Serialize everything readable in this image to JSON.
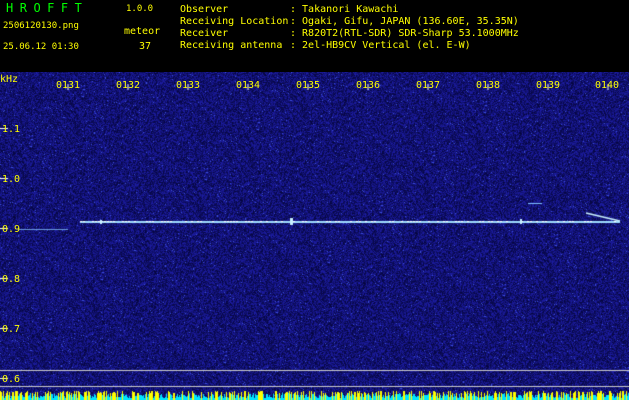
{
  "header": {
    "app_title": "HROFFT",
    "version": "1.0.0",
    "filename": "2506120130.png",
    "meteor_label": "meteor",
    "datetime": "25.06.12 01:30",
    "meteor_count": "37",
    "info": [
      {
        "label": "Observer",
        "value": ": Takanori Kawachi"
      },
      {
        "label": "Receiving Location",
        "value": ": Ogaki, Gifu, JAPAN (136.60E, 35.35N)"
      },
      {
        "label": "Receiver",
        "value": ": R820T2(RTL-SDR) SDR-Sharp 53.1000MHz"
      },
      {
        "label": "Receiving antenna",
        "value": ": 2el-HB9CV Vertical (el. E-W)"
      }
    ]
  },
  "axes": {
    "unit": "kHz",
    "x_ticks": [
      "0131",
      "0132",
      "0133",
      "0134",
      "0135",
      "0136",
      "0137",
      "0138",
      "0139",
      "0140"
    ],
    "y_ticks": [
      "1.1",
      "1.0",
      "0.9",
      "0.8",
      "0.7",
      "0.6"
    ]
  },
  "colors": {
    "background": "#000000",
    "spectrogram_base": "#0a0a6e",
    "header_green": "#00ff00",
    "header_yellow": "#ffff00",
    "trace": "#aaeeff"
  }
}
